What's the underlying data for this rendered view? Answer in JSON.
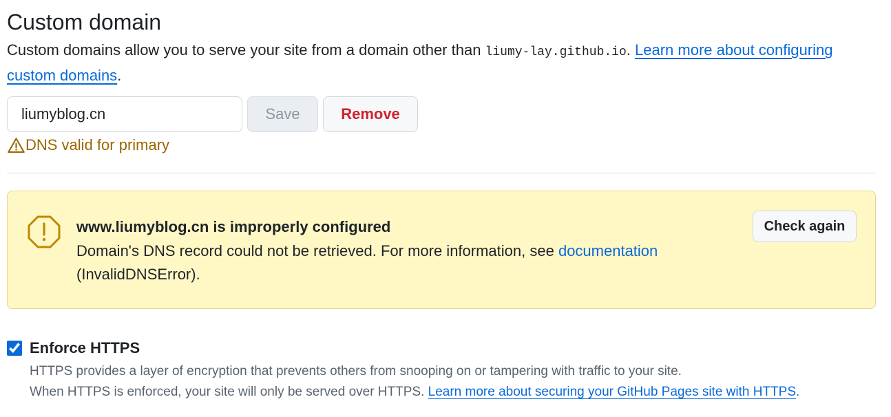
{
  "custom_domain": {
    "title": "Custom domain",
    "description_prefix": "Custom domains allow you to serve your site from a domain other than ",
    "default_domain": "liumy-lay.github.io",
    "description_sep": ". ",
    "learn_more_link": "Learn more about configuring custom domains",
    "description_suffix": ".",
    "input_value": "liumyblog.cn",
    "save_label": "Save",
    "remove_label": "Remove",
    "dns_status": "DNS valid for primary",
    "dns_status_color": "#9a6700"
  },
  "flash": {
    "heading": "www.liumyblog.cn is improperly configured",
    "message_prefix": "Domain's DNS record could not be retrieved. For more information, see ",
    "doc_link": "documentation",
    "message_suffix": " (InvalidDNSError).",
    "check_again_label": "Check again",
    "background_color": "#fff8c5",
    "icon": "alert-octagon-icon"
  },
  "https": {
    "checked": true,
    "label": "Enforce HTTPS",
    "note_line1": "HTTPS provides a layer of encryption that prevents others from snooping on or tampering with traffic to your site.",
    "note_line2_prefix": "When HTTPS is enforced, your site will only be served over HTTPS. ",
    "learn_more_link": "Learn more about securing your GitHub Pages site with HTTPS",
    "note_line2_suffix": "."
  },
  "colors": {
    "link": "#0969da",
    "danger": "#cf222e",
    "text": "#1f2328",
    "muted": "#59636e"
  }
}
